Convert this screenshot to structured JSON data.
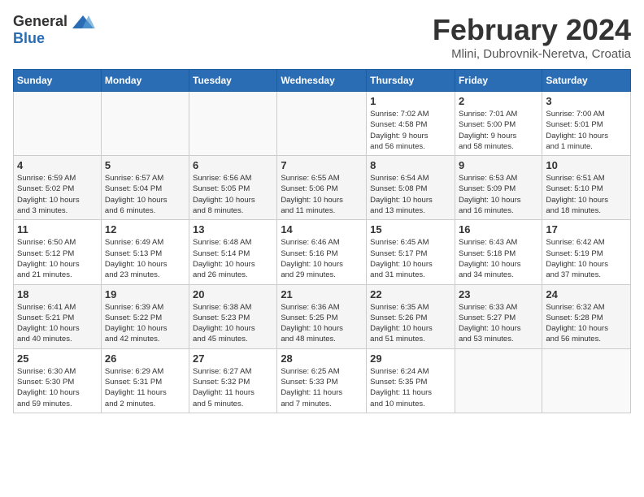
{
  "logo": {
    "general": "General",
    "blue": "Blue"
  },
  "title": "February 2024",
  "location": "Mlini, Dubrovnik-Neretva, Croatia",
  "weekdays": [
    "Sunday",
    "Monday",
    "Tuesday",
    "Wednesday",
    "Thursday",
    "Friday",
    "Saturday"
  ],
  "weeks": [
    [
      {
        "day": "",
        "info": ""
      },
      {
        "day": "",
        "info": ""
      },
      {
        "day": "",
        "info": ""
      },
      {
        "day": "",
        "info": ""
      },
      {
        "day": "1",
        "info": "Sunrise: 7:02 AM\nSunset: 4:58 PM\nDaylight: 9 hours\nand 56 minutes."
      },
      {
        "day": "2",
        "info": "Sunrise: 7:01 AM\nSunset: 5:00 PM\nDaylight: 9 hours\nand 58 minutes."
      },
      {
        "day": "3",
        "info": "Sunrise: 7:00 AM\nSunset: 5:01 PM\nDaylight: 10 hours\nand 1 minute."
      }
    ],
    [
      {
        "day": "4",
        "info": "Sunrise: 6:59 AM\nSunset: 5:02 PM\nDaylight: 10 hours\nand 3 minutes."
      },
      {
        "day": "5",
        "info": "Sunrise: 6:57 AM\nSunset: 5:04 PM\nDaylight: 10 hours\nand 6 minutes."
      },
      {
        "day": "6",
        "info": "Sunrise: 6:56 AM\nSunset: 5:05 PM\nDaylight: 10 hours\nand 8 minutes."
      },
      {
        "day": "7",
        "info": "Sunrise: 6:55 AM\nSunset: 5:06 PM\nDaylight: 10 hours\nand 11 minutes."
      },
      {
        "day": "8",
        "info": "Sunrise: 6:54 AM\nSunset: 5:08 PM\nDaylight: 10 hours\nand 13 minutes."
      },
      {
        "day": "9",
        "info": "Sunrise: 6:53 AM\nSunset: 5:09 PM\nDaylight: 10 hours\nand 16 minutes."
      },
      {
        "day": "10",
        "info": "Sunrise: 6:51 AM\nSunset: 5:10 PM\nDaylight: 10 hours\nand 18 minutes."
      }
    ],
    [
      {
        "day": "11",
        "info": "Sunrise: 6:50 AM\nSunset: 5:12 PM\nDaylight: 10 hours\nand 21 minutes."
      },
      {
        "day": "12",
        "info": "Sunrise: 6:49 AM\nSunset: 5:13 PM\nDaylight: 10 hours\nand 23 minutes."
      },
      {
        "day": "13",
        "info": "Sunrise: 6:48 AM\nSunset: 5:14 PM\nDaylight: 10 hours\nand 26 minutes."
      },
      {
        "day": "14",
        "info": "Sunrise: 6:46 AM\nSunset: 5:16 PM\nDaylight: 10 hours\nand 29 minutes."
      },
      {
        "day": "15",
        "info": "Sunrise: 6:45 AM\nSunset: 5:17 PM\nDaylight: 10 hours\nand 31 minutes."
      },
      {
        "day": "16",
        "info": "Sunrise: 6:43 AM\nSunset: 5:18 PM\nDaylight: 10 hours\nand 34 minutes."
      },
      {
        "day": "17",
        "info": "Sunrise: 6:42 AM\nSunset: 5:19 PM\nDaylight: 10 hours\nand 37 minutes."
      }
    ],
    [
      {
        "day": "18",
        "info": "Sunrise: 6:41 AM\nSunset: 5:21 PM\nDaylight: 10 hours\nand 40 minutes."
      },
      {
        "day": "19",
        "info": "Sunrise: 6:39 AM\nSunset: 5:22 PM\nDaylight: 10 hours\nand 42 minutes."
      },
      {
        "day": "20",
        "info": "Sunrise: 6:38 AM\nSunset: 5:23 PM\nDaylight: 10 hours\nand 45 minutes."
      },
      {
        "day": "21",
        "info": "Sunrise: 6:36 AM\nSunset: 5:25 PM\nDaylight: 10 hours\nand 48 minutes."
      },
      {
        "day": "22",
        "info": "Sunrise: 6:35 AM\nSunset: 5:26 PM\nDaylight: 10 hours\nand 51 minutes."
      },
      {
        "day": "23",
        "info": "Sunrise: 6:33 AM\nSunset: 5:27 PM\nDaylight: 10 hours\nand 53 minutes."
      },
      {
        "day": "24",
        "info": "Sunrise: 6:32 AM\nSunset: 5:28 PM\nDaylight: 10 hours\nand 56 minutes."
      }
    ],
    [
      {
        "day": "25",
        "info": "Sunrise: 6:30 AM\nSunset: 5:30 PM\nDaylight: 10 hours\nand 59 minutes."
      },
      {
        "day": "26",
        "info": "Sunrise: 6:29 AM\nSunset: 5:31 PM\nDaylight: 11 hours\nand 2 minutes."
      },
      {
        "day": "27",
        "info": "Sunrise: 6:27 AM\nSunset: 5:32 PM\nDaylight: 11 hours\nand 5 minutes."
      },
      {
        "day": "28",
        "info": "Sunrise: 6:25 AM\nSunset: 5:33 PM\nDaylight: 11 hours\nand 7 minutes."
      },
      {
        "day": "29",
        "info": "Sunrise: 6:24 AM\nSunset: 5:35 PM\nDaylight: 11 hours\nand 10 minutes."
      },
      {
        "day": "",
        "info": ""
      },
      {
        "day": "",
        "info": ""
      }
    ]
  ]
}
